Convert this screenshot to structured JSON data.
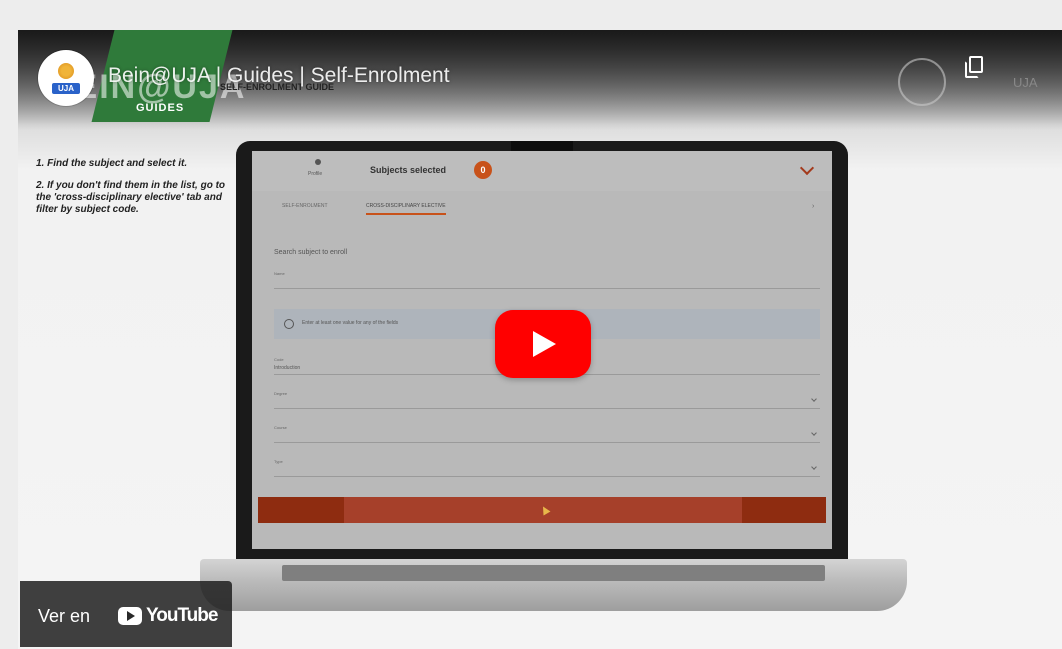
{
  "video": {
    "title": "Bein@UJA | Guides | Self-Enrolment",
    "brand_ghost": "BEIN@UJA",
    "brand_guides": "GUIDES",
    "brand_sub": "SELF-ENROLMENT GUIDE",
    "avatar_badge": "UJA",
    "top_right_code": "UJA"
  },
  "instructions": {
    "step1": "1. Find the subject and select it.",
    "step2": "2. If you don't find them in the list, go to the 'cross-disciplinary elective' tab and filter by subject code."
  },
  "app": {
    "profile_label": "Profile",
    "subjects_label": "Subjects selected",
    "subjects_count": "0",
    "tabs": [
      "SELF-ENROLMENT",
      "CROSS-DISCIPLINARY ELECTIVE"
    ],
    "tab_more": "›",
    "search_title": "Search subject to enroll",
    "fields": [
      {
        "label": "Name",
        "value": ""
      },
      {
        "label": "Code",
        "value": "Introduction"
      },
      {
        "label": "Degree",
        "value": ""
      },
      {
        "label": "Course",
        "value": ""
      },
      {
        "label": "Type",
        "value": ""
      }
    ],
    "info_text": "Enter at least one value for any of the fields"
  },
  "controls": {
    "watch_on_label": "Ver en",
    "youtube_wordmark": "YouTube",
    "play_icon": "play-icon",
    "copy_icon": "copy-link-icon"
  },
  "colors": {
    "play_red": "#ff0000",
    "brand_green": "#2f7a3a",
    "accent_orange": "#c8521a",
    "enrol_bar": "#8e2c10"
  }
}
